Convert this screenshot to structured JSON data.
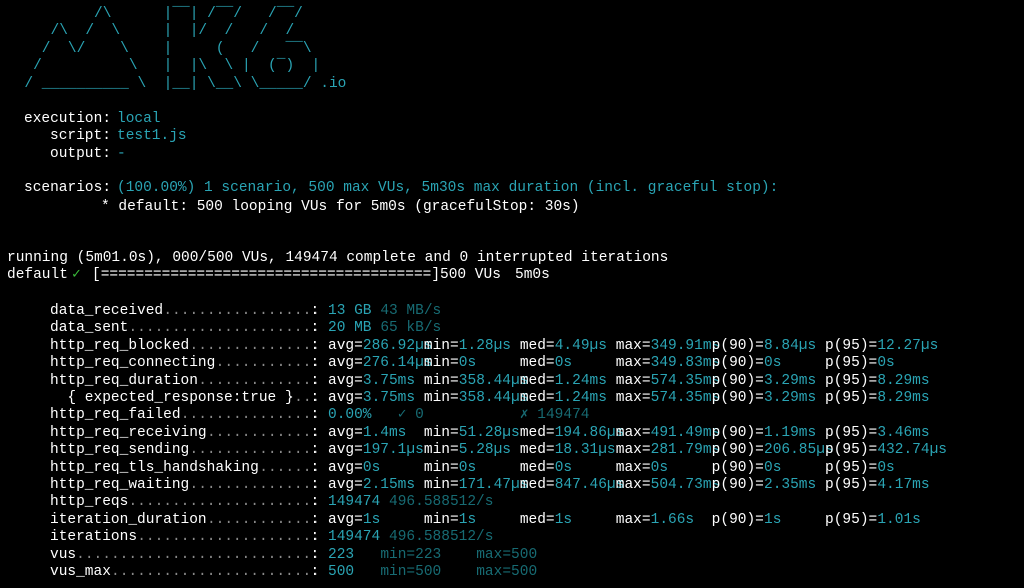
{
  "logo": {
    "lines": [
      "          /\\      |‾‾| /‾‾/   /‾‾/",
      "     /\\  /  \\     |  |/  /   /  /",
      "    /  \\/    \\    |     (   /   ‾‾\\",
      "   /          \\   |  |\\  \\ |  (‾)  |",
      "  / __________ \\  |__| \\__\\ \\_____/ .io"
    ]
  },
  "options": {
    "execution_label": "execution:",
    "execution_value": "local",
    "script_label": "script:",
    "script_value": "test1.js",
    "output_label": "output:",
    "output_value": "-"
  },
  "scenarios": {
    "label": "scenarios:",
    "summary": "(100.00%) 1 scenario, 500 max VUs, 5m30s max duration (incl. graceful stop):",
    "detail": "* default: 500 looping VUs for 5m0s (gracefulStop: 30s)"
  },
  "run": {
    "status": "running (5m01.0s), 000/500 VUs, 149474 complete and 0 interrupted iterations",
    "scenario_name": "default",
    "check_mark": "✓",
    "progress_bar": "[======================================]",
    "vus": "500 VUs",
    "duration": "5m0s"
  },
  "metrics": [
    {
      "name": "data_received",
      "dots": "..................",
      "parts": [
        {
          "col": 0,
          "text": "13 GB",
          "cls": "teal"
        },
        {
          "col": 6,
          "text": "43 MB/s",
          "cls": "dim"
        }
      ]
    },
    {
      "name": "data_sent",
      "dots": "......................",
      "parts": [
        {
          "col": 0,
          "text": "20 MB",
          "cls": "teal"
        },
        {
          "col": 6,
          "text": "65 kB/s",
          "cls": "dim"
        }
      ]
    },
    {
      "name": "http_req_blocked",
      "dots": "...............",
      "parts": [
        {
          "col": 0,
          "text": "avg=",
          "cls": "wht"
        },
        {
          "col": 4,
          "text": "286.92µs",
          "cls": "teal"
        },
        {
          "col": 11,
          "text": "min=",
          "cls": "wht"
        },
        {
          "col": 15,
          "text": "1.28µs",
          "cls": "teal"
        },
        {
          "col": 22,
          "text": "med=",
          "cls": "wht"
        },
        {
          "col": 26,
          "text": "4.49µs",
          "cls": "teal"
        },
        {
          "col": 33,
          "text": "max=",
          "cls": "wht"
        },
        {
          "col": 37,
          "text": "349.91ms",
          "cls": "teal"
        },
        {
          "col": 44,
          "text": "p(90)=",
          "cls": "wht"
        },
        {
          "col": 50,
          "text": "8.84µs",
          "cls": "teal"
        },
        {
          "col": 57,
          "text": "p(95)=",
          "cls": "wht"
        },
        {
          "col": 63,
          "text": "12.27µs",
          "cls": "teal"
        }
      ]
    },
    {
      "name": "http_req_connecting",
      "dots": "............",
      "parts": [
        {
          "col": 0,
          "text": "avg=",
          "cls": "wht"
        },
        {
          "col": 4,
          "text": "276.14µs",
          "cls": "teal"
        },
        {
          "col": 11,
          "text": "min=",
          "cls": "wht"
        },
        {
          "col": 15,
          "text": "0s",
          "cls": "teal"
        },
        {
          "col": 22,
          "text": "med=",
          "cls": "wht"
        },
        {
          "col": 26,
          "text": "0s",
          "cls": "teal"
        },
        {
          "col": 33,
          "text": "max=",
          "cls": "wht"
        },
        {
          "col": 37,
          "text": "349.83ms",
          "cls": "teal"
        },
        {
          "col": 44,
          "text": "p(90)=",
          "cls": "wht"
        },
        {
          "col": 50,
          "text": "0s",
          "cls": "teal"
        },
        {
          "col": 57,
          "text": "p(95)=",
          "cls": "wht"
        },
        {
          "col": 63,
          "text": "0s",
          "cls": "teal"
        }
      ]
    },
    {
      "name": "http_req_duration",
      "dots": "..............",
      "parts": [
        {
          "col": 0,
          "text": "avg=",
          "cls": "wht"
        },
        {
          "col": 4,
          "text": "3.75ms",
          "cls": "teal"
        },
        {
          "col": 11,
          "text": "min=",
          "cls": "wht"
        },
        {
          "col": 15,
          "text": "358.44µs",
          "cls": "teal"
        },
        {
          "col": 22,
          "text": "med=",
          "cls": "wht"
        },
        {
          "col": 26,
          "text": "1.24ms",
          "cls": "teal"
        },
        {
          "col": 33,
          "text": "max=",
          "cls": "wht"
        },
        {
          "col": 37,
          "text": "574.35ms",
          "cls": "teal"
        },
        {
          "col": 44,
          "text": "p(90)=",
          "cls": "wht"
        },
        {
          "col": 50,
          "text": "3.29ms",
          "cls": "teal"
        },
        {
          "col": 57,
          "text": "p(95)=",
          "cls": "wht"
        },
        {
          "col": 63,
          "text": "8.29ms",
          "cls": "teal"
        }
      ]
    },
    {
      "name": "  { expected_response:true }",
      "dots": "...",
      "parts": [
        {
          "col": 0,
          "text": "avg=",
          "cls": "wht"
        },
        {
          "col": 4,
          "text": "3.75ms",
          "cls": "teal"
        },
        {
          "col": 11,
          "text": "min=",
          "cls": "wht"
        },
        {
          "col": 15,
          "text": "358.44µs",
          "cls": "teal"
        },
        {
          "col": 22,
          "text": "med=",
          "cls": "wht"
        },
        {
          "col": 26,
          "text": "1.24ms",
          "cls": "teal"
        },
        {
          "col": 33,
          "text": "max=",
          "cls": "wht"
        },
        {
          "col": 37,
          "text": "574.35ms",
          "cls": "teal"
        },
        {
          "col": 44,
          "text": "p(90)=",
          "cls": "wht"
        },
        {
          "col": 50,
          "text": "3.29ms",
          "cls": "teal"
        },
        {
          "col": 57,
          "text": "p(95)=",
          "cls": "wht"
        },
        {
          "col": 63,
          "text": "8.29ms",
          "cls": "teal"
        }
      ]
    },
    {
      "name": "http_req_failed",
      "dots": "................",
      "parts": [
        {
          "col": 0,
          "text": "0.00%",
          "cls": "teal"
        },
        {
          "col": 8,
          "text": "✓ 0",
          "cls": "dim"
        },
        {
          "col": 22,
          "text": "✗ 149474",
          "cls": "dim"
        }
      ]
    },
    {
      "name": "http_req_receiving",
      "dots": ".............",
      "parts": [
        {
          "col": 0,
          "text": "avg=",
          "cls": "wht"
        },
        {
          "col": 4,
          "text": "1.4ms",
          "cls": "teal"
        },
        {
          "col": 11,
          "text": "min=",
          "cls": "wht"
        },
        {
          "col": 15,
          "text": "51.28µs",
          "cls": "teal"
        },
        {
          "col": 22,
          "text": "med=",
          "cls": "wht"
        },
        {
          "col": 26,
          "text": "194.86µs",
          "cls": "teal"
        },
        {
          "col": 33,
          "text": "max=",
          "cls": "wht"
        },
        {
          "col": 37,
          "text": "491.49ms",
          "cls": "teal"
        },
        {
          "col": 44,
          "text": "p(90)=",
          "cls": "wht"
        },
        {
          "col": 50,
          "text": "1.19ms",
          "cls": "teal"
        },
        {
          "col": 57,
          "text": "p(95)=",
          "cls": "wht"
        },
        {
          "col": 63,
          "text": "3.46ms",
          "cls": "teal"
        }
      ]
    },
    {
      "name": "http_req_sending",
      "dots": "...............",
      "parts": [
        {
          "col": 0,
          "text": "avg=",
          "cls": "wht"
        },
        {
          "col": 4,
          "text": "197.1µs",
          "cls": "teal"
        },
        {
          "col": 11,
          "text": "min=",
          "cls": "wht"
        },
        {
          "col": 15,
          "text": "5.28µs",
          "cls": "teal"
        },
        {
          "col": 22,
          "text": "med=",
          "cls": "wht"
        },
        {
          "col": 26,
          "text": "18.31µs",
          "cls": "teal"
        },
        {
          "col": 33,
          "text": "max=",
          "cls": "wht"
        },
        {
          "col": 37,
          "text": "281.79ms",
          "cls": "teal"
        },
        {
          "col": 44,
          "text": "p(90)=",
          "cls": "wht"
        },
        {
          "col": 50,
          "text": "206.85µs",
          "cls": "teal"
        },
        {
          "col": 57,
          "text": "p(95)=",
          "cls": "wht"
        },
        {
          "col": 63,
          "text": "432.74µs",
          "cls": "teal"
        }
      ]
    },
    {
      "name": "http_req_tls_handshaking",
      "dots": ".......",
      "parts": [
        {
          "col": 0,
          "text": "avg=",
          "cls": "wht"
        },
        {
          "col": 4,
          "text": "0s",
          "cls": "teal"
        },
        {
          "col": 11,
          "text": "min=",
          "cls": "wht"
        },
        {
          "col": 15,
          "text": "0s",
          "cls": "teal"
        },
        {
          "col": 22,
          "text": "med=",
          "cls": "wht"
        },
        {
          "col": 26,
          "text": "0s",
          "cls": "teal"
        },
        {
          "col": 33,
          "text": "max=",
          "cls": "wht"
        },
        {
          "col": 37,
          "text": "0s",
          "cls": "teal"
        },
        {
          "col": 44,
          "text": "p(90)=",
          "cls": "wht"
        },
        {
          "col": 50,
          "text": "0s",
          "cls": "teal"
        },
        {
          "col": 57,
          "text": "p(95)=",
          "cls": "wht"
        },
        {
          "col": 63,
          "text": "0s",
          "cls": "teal"
        }
      ]
    },
    {
      "name": "http_req_waiting",
      "dots": "...............",
      "parts": [
        {
          "col": 0,
          "text": "avg=",
          "cls": "wht"
        },
        {
          "col": 4,
          "text": "2.15ms",
          "cls": "teal"
        },
        {
          "col": 11,
          "text": "min=",
          "cls": "wht"
        },
        {
          "col": 15,
          "text": "171.47µs",
          "cls": "teal"
        },
        {
          "col": 22,
          "text": "med=",
          "cls": "wht"
        },
        {
          "col": 26,
          "text": "847.46µs",
          "cls": "teal"
        },
        {
          "col": 33,
          "text": "max=",
          "cls": "wht"
        },
        {
          "col": 37,
          "text": "504.73ms",
          "cls": "teal"
        },
        {
          "col": 44,
          "text": "p(90)=",
          "cls": "wht"
        },
        {
          "col": 50,
          "text": "2.35ms",
          "cls": "teal"
        },
        {
          "col": 57,
          "text": "p(95)=",
          "cls": "wht"
        },
        {
          "col": 63,
          "text": "4.17ms",
          "cls": "teal"
        }
      ]
    },
    {
      "name": "http_reqs",
      "dots": "......................",
      "parts": [
        {
          "col": 0,
          "text": "149474",
          "cls": "teal"
        },
        {
          "col": 7,
          "text": "496.588512/s",
          "cls": "dim"
        }
      ]
    },
    {
      "name": "iteration_duration",
      "dots": ".............",
      "parts": [
        {
          "col": 0,
          "text": "avg=",
          "cls": "wht"
        },
        {
          "col": 4,
          "text": "1s",
          "cls": "teal"
        },
        {
          "col": 11,
          "text": "min=",
          "cls": "wht"
        },
        {
          "col": 15,
          "text": "1s",
          "cls": "teal"
        },
        {
          "col": 22,
          "text": "med=",
          "cls": "wht"
        },
        {
          "col": 26,
          "text": "1s",
          "cls": "teal"
        },
        {
          "col": 33,
          "text": "max=",
          "cls": "wht"
        },
        {
          "col": 37,
          "text": "1.66s",
          "cls": "teal"
        },
        {
          "col": 44,
          "text": "p(90)=",
          "cls": "wht"
        },
        {
          "col": 50,
          "text": "1s",
          "cls": "teal"
        },
        {
          "col": 57,
          "text": "p(95)=",
          "cls": "wht"
        },
        {
          "col": 63,
          "text": "1.01s",
          "cls": "teal"
        }
      ]
    },
    {
      "name": "iterations",
      "dots": ".....................",
      "parts": [
        {
          "col": 0,
          "text": "149474",
          "cls": "teal"
        },
        {
          "col": 7,
          "text": "496.588512/s",
          "cls": "dim"
        }
      ]
    },
    {
      "name": "vus",
      "dots": "............................",
      "parts": [
        {
          "col": 0,
          "text": "223",
          "cls": "teal"
        },
        {
          "col": 6,
          "text": "min=223",
          "cls": "dim"
        },
        {
          "col": 17,
          "text": "max=500",
          "cls": "dim"
        }
      ]
    },
    {
      "name": "vus_max",
      "dots": "........................",
      "parts": [
        {
          "col": 0,
          "text": "500",
          "cls": "teal"
        },
        {
          "col": 6,
          "text": "min=500",
          "cls": "dim"
        },
        {
          "col": 17,
          "text": "max=500",
          "cls": "dim"
        }
      ]
    }
  ],
  "colors": {
    "background": "#000000",
    "accent": "#2aa4b4",
    "dim": "#176b73",
    "check": "#3bbf3b",
    "text": "#ffffff"
  }
}
